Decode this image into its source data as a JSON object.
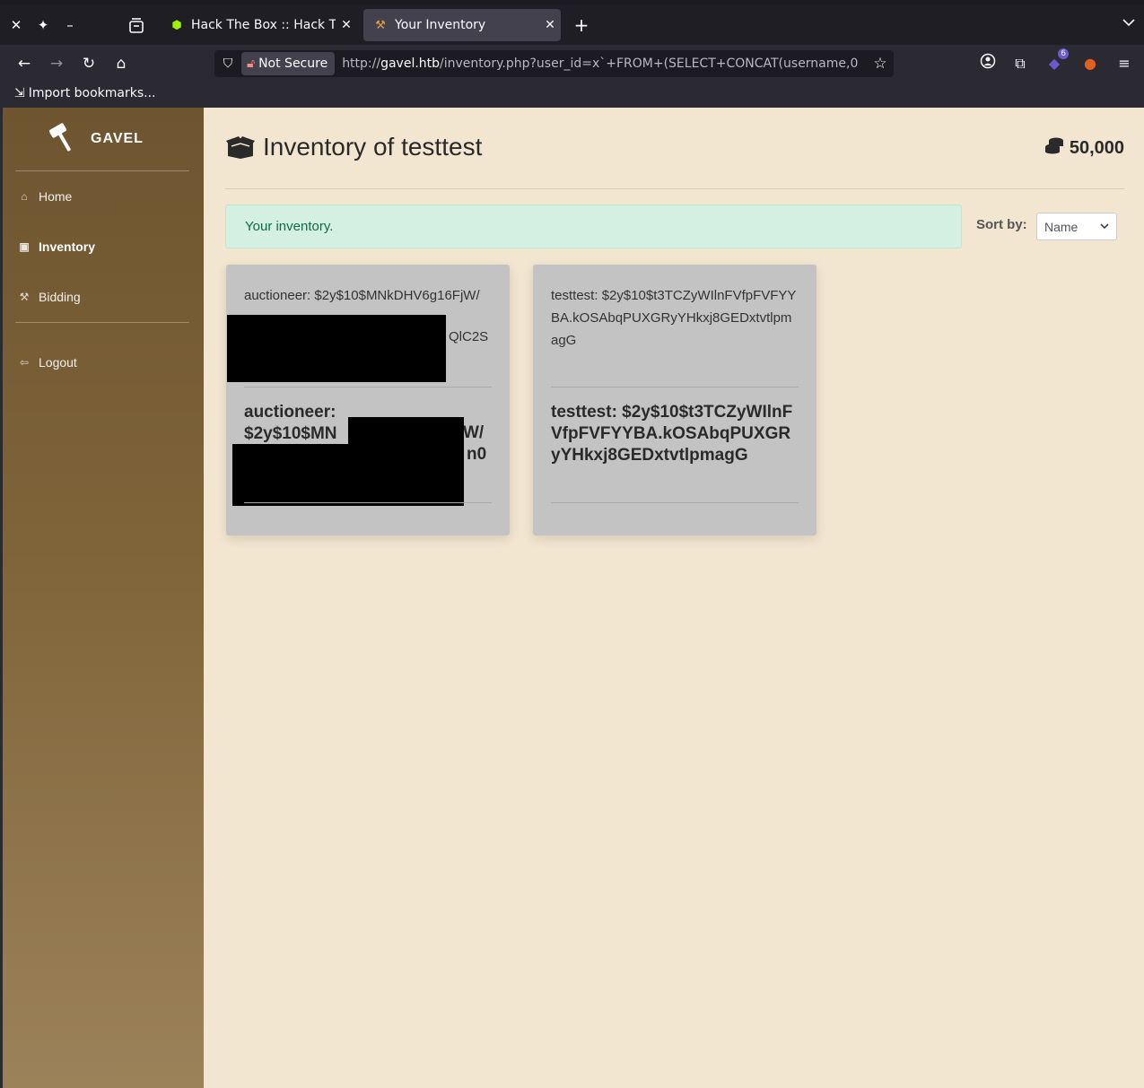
{
  "browser": {
    "tabs": [
      {
        "label": "Hack The Box :: Hack The Box",
        "active": false
      },
      {
        "label": "Your Inventory",
        "active": true
      }
    ],
    "security_label": "Not Secure",
    "url_host": "gavel.htb",
    "url_prefix": "http://",
    "url_rest": "/inventory.php?user_id=x`+FROM+(SELECT+CONCAT(username,0",
    "extension_badge": "6",
    "bookmarks_item": "Import bookmarks..."
  },
  "sidebar": {
    "brand": "GAVEL",
    "items": [
      {
        "label": "Home",
        "icon": "home-icon"
      },
      {
        "label": "Inventory",
        "icon": "box-icon",
        "active": true
      },
      {
        "label": "Bidding",
        "icon": "gavel-icon"
      },
      {
        "label": "Logout",
        "icon": "logout-icon"
      }
    ]
  },
  "page": {
    "title": "Inventory of testtest",
    "balance": "50,000",
    "alert": "Your inventory.",
    "sort_label": "Sort by:",
    "sort_value": "Name"
  },
  "items": [
    {
      "description": "auctioneer: $2y$10$MNkDHV6g16FjW/",
      "description_tail": "QlC2S",
      "title_line1": "auctioneer:",
      "title_line2": "$2y$10$MN",
      "title_frag_a": "W/",
      "title_frag_b": "n0"
    },
    {
      "description": "testtest: $2y$10$t3TCZyWIlnFVfpFVFYYBA.kOSAbqPUXGRyYHkxj8GEDxtvtlpmagG",
      "title": "testtest: $2y$10$t3TCZyWIlnFVfpFVFYYBA.kOSAbqPUXGRyYHkxj8GEDxtvtlpmagG"
    }
  ],
  "colors": {
    "sidebar_top": "#6e5530",
    "page_bg": "#f2e6d0",
    "alert_bg": "#d3f0e3",
    "card_bg": "#c3c3c3"
  }
}
